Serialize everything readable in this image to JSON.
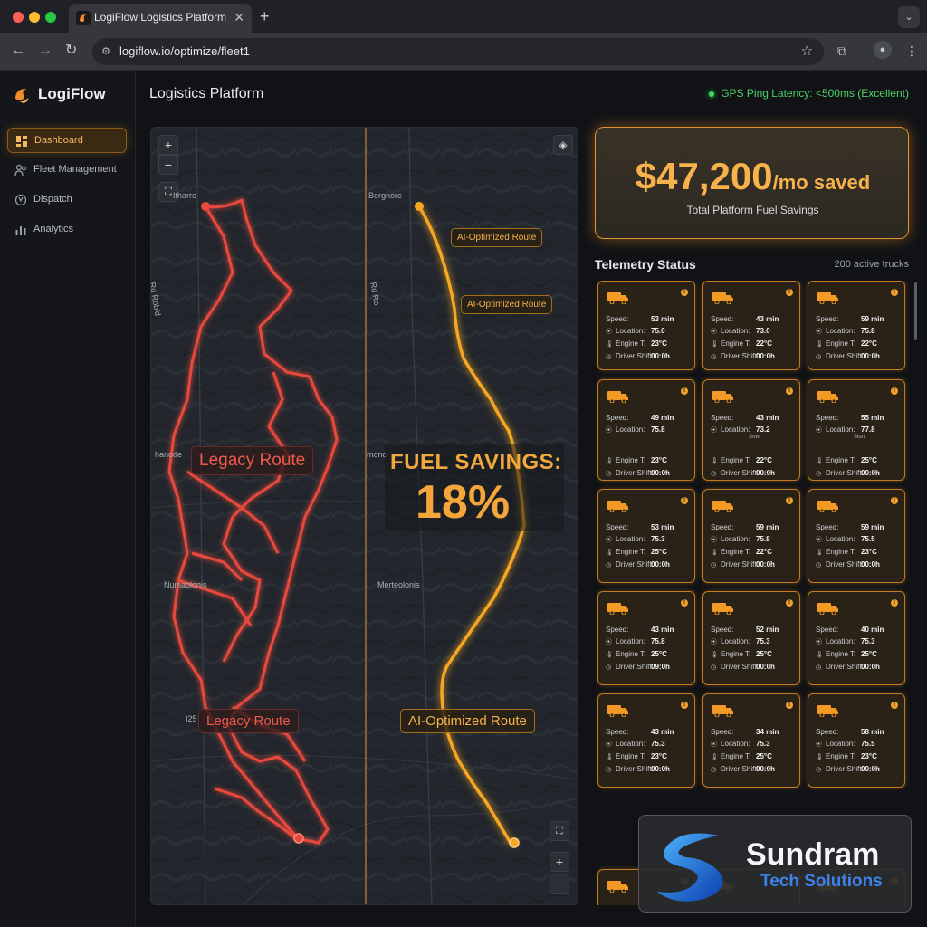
{
  "browser": {
    "tab_title": "LogiFlow Logistics Platform",
    "url": "logiflow.io/optimize/fleet1"
  },
  "sidebar": {
    "brand": "LogiFlow",
    "items": [
      {
        "label": "Dashboard",
        "icon": "dashboard-icon"
      },
      {
        "label": "Fleet Management",
        "icon": "fleet-icon"
      },
      {
        "label": "Dispatch",
        "icon": "dispatch-icon"
      },
      {
        "label": "Analytics",
        "icon": "analytics-icon"
      }
    ]
  },
  "header": {
    "title": "Logistics Platform",
    "latency": "GPS Ping Latency: <500ms (Excellent)"
  },
  "map": {
    "legacy_label": "Legacy Route",
    "ai_label": "AI-Optimized Route",
    "fuel_title": "FUEL SAVINGS:",
    "fuel_value": "18%",
    "fuel_savings_percent": 18,
    "places": {
      "left_top": "Itharre",
      "right_top": "Bergnore",
      "left_mid": "hanode",
      "right_mid": "monc",
      "left_low": "Numaolonis",
      "right_low": "Merteolonis",
      "left_bottom": "I25",
      "road_left": "Rd Robid",
      "road_right": "Rd Ro"
    },
    "colors": {
      "legacy": "#e8493c",
      "ai": "#f5a623"
    }
  },
  "savings": {
    "amount": "$47,200",
    "suffix": "/mo saved",
    "label": "Total Platform Fuel Savings"
  },
  "telemetry": {
    "title": "Telemetry Status",
    "count": "200 active trucks",
    "labels": {
      "speed": "Speed:",
      "location": "Location:",
      "engine": "Engine T:",
      "shift": "Driver Shift:"
    },
    "cards": [
      {
        "speed": "53 min",
        "location": "75.0",
        "engine": "23°C",
        "shift": "00:0h"
      },
      {
        "speed": "43 min",
        "location": "73.0",
        "engine": "22°C",
        "shift": "00:0h"
      },
      {
        "speed": "59 min",
        "location": "75.8",
        "engine": "22°C",
        "shift": "00:0h"
      },
      {
        "speed": "49 min",
        "location": "75.8",
        "engine": "23°C",
        "shift": "00:0h"
      },
      {
        "speed": "43 min",
        "location": "73.2",
        "engine": "22°C",
        "shift": "00:0h",
        "note": "Sow"
      },
      {
        "speed": "55 min",
        "location": "77.8",
        "engine": "25°C",
        "shift": "00:0h",
        "note": "Slurt"
      },
      {
        "speed": "53 min",
        "location": "75.3",
        "engine": "25°C",
        "shift": "00:0h"
      },
      {
        "speed": "59 min",
        "location": "75.8",
        "engine": "22°C",
        "shift": "00:0h"
      },
      {
        "speed": "59 min",
        "location": "75.5",
        "engine": "23°C",
        "shift": "00:0h"
      },
      {
        "speed": "43 min",
        "location": "75.8",
        "engine": "25°C",
        "shift": "09:0h"
      },
      {
        "speed": "52 min",
        "location": "75.3",
        "engine": "25°C",
        "shift": "00:0h"
      },
      {
        "speed": "40 min",
        "location": "75.3",
        "engine": "25°C",
        "shift": "00:0h"
      },
      {
        "speed": "43 min",
        "location": "75.3",
        "engine": "23°C",
        "shift": "00:0h"
      },
      {
        "speed": "34 min",
        "location": "75.3",
        "engine": "25°C",
        "shift": "00:0h"
      },
      {
        "speed": "58 min",
        "location": "75.5",
        "engine": "23°C",
        "shift": "00:0h"
      }
    ],
    "partial_labels": {
      "speed": "Speed:",
      "location": "Locati",
      "engine": "Englo",
      "shift": "Driver"
    }
  },
  "watermark": {
    "name": "Sundram",
    "sub": "Tech Solutions"
  }
}
